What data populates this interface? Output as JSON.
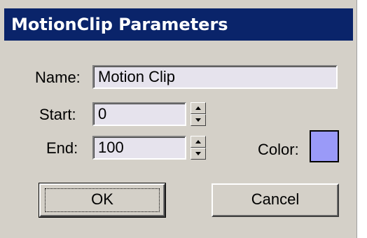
{
  "dialog": {
    "title": "MotionClip Parameters"
  },
  "fields": {
    "name_label": "Name:",
    "name_value": "Motion Clip",
    "start_label": "Start:",
    "start_value": "0",
    "end_label": "End:",
    "end_value": "100",
    "color_label": "Color:",
    "color_value": "#9a9af8"
  },
  "buttons": {
    "ok_label": "OK",
    "cancel_label": "Cancel"
  },
  "icons": {
    "spinner_up": "spinner-up-icon",
    "spinner_down": "spinner-down-icon"
  }
}
